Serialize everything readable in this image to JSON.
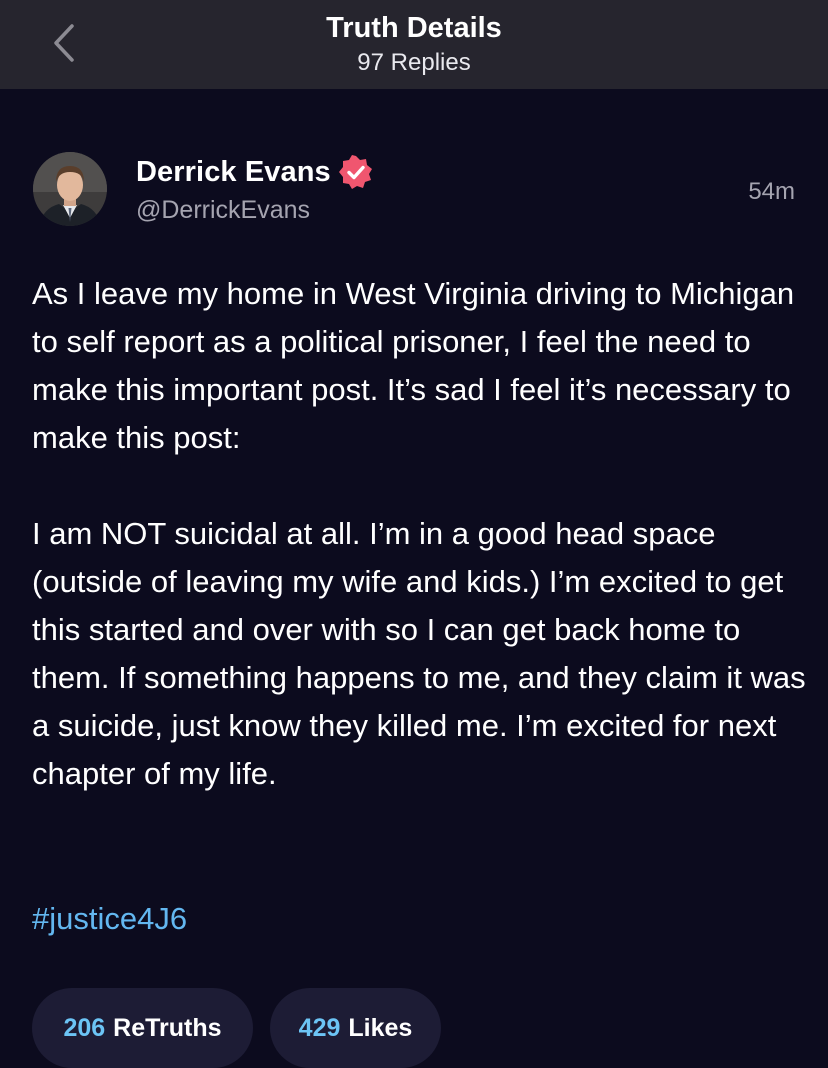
{
  "header": {
    "title": "Truth Details",
    "subtitle": "97 Replies",
    "back_icon": "chevron-left-icon"
  },
  "post": {
    "author_name": "Derrick Evans",
    "author_handle": "@DerrickEvans",
    "verified_icon": "verified-badge-icon",
    "timestamp": "54m",
    "paragraph_1": "As I leave my home in West Virginia driving to Michigan to self report as a political prisoner, I feel the need to make this important post. It’s sad I feel it’s necessary to make this post:",
    "paragraph_2": "I am NOT suicidal at all. I’m in a good head space (outside of leaving my wife and kids.) I’m excited to get this started and over with so I can get back home to them. If something happens to me, and they claim it was a suicide, just know they killed me. I’m excited for next chapter of my life.",
    "hashtag": "#justice4J6"
  },
  "stats": {
    "retruths_count": "206",
    "retruths_label": "ReTruths",
    "likes_count": "429",
    "likes_label": "Likes"
  },
  "colors": {
    "background": "#0c0b1e",
    "header_bg": "#26252e",
    "accent_link": "#63b7f0",
    "verified_badge": "#f0566f",
    "pill_bg": "#1d1c35"
  }
}
